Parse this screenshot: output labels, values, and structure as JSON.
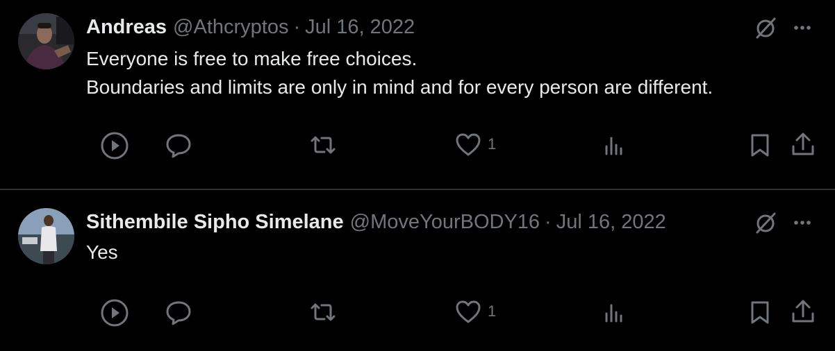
{
  "tweets": [
    {
      "display_name": "Andreas",
      "handle": "@Athcryptos",
      "separator": "·",
      "date": "Jul 16, 2022",
      "text_lines": [
        "Everyone is free to make free choices.",
        "Boundaries and limits are only in mind and for every person are different."
      ],
      "likes": "1",
      "avatar_icon": "user-avatar-photo"
    },
    {
      "display_name": "Sithembile Sipho Simelane",
      "handle": "@MoveYourBODY16",
      "separator": "·",
      "date": "Jul 16, 2022",
      "text_lines": [
        "Yes"
      ],
      "likes": "1",
      "avatar_icon": "user-avatar-photo"
    }
  ],
  "icons": {
    "grok": "grok-slash-circle-icon",
    "more": "more-horizontal-icon",
    "play": "play-circle-icon",
    "reply": "speech-bubble-icon",
    "retweet": "retweet-arrows-icon",
    "like": "heart-icon",
    "views": "bar-chart-icon",
    "bookmark": "bookmark-icon",
    "share": "share-upload-icon"
  },
  "colors": {
    "background": "#000000",
    "primary_text": "#e7e9ea",
    "secondary_text": "#71767b",
    "divider": "#2f3336"
  }
}
